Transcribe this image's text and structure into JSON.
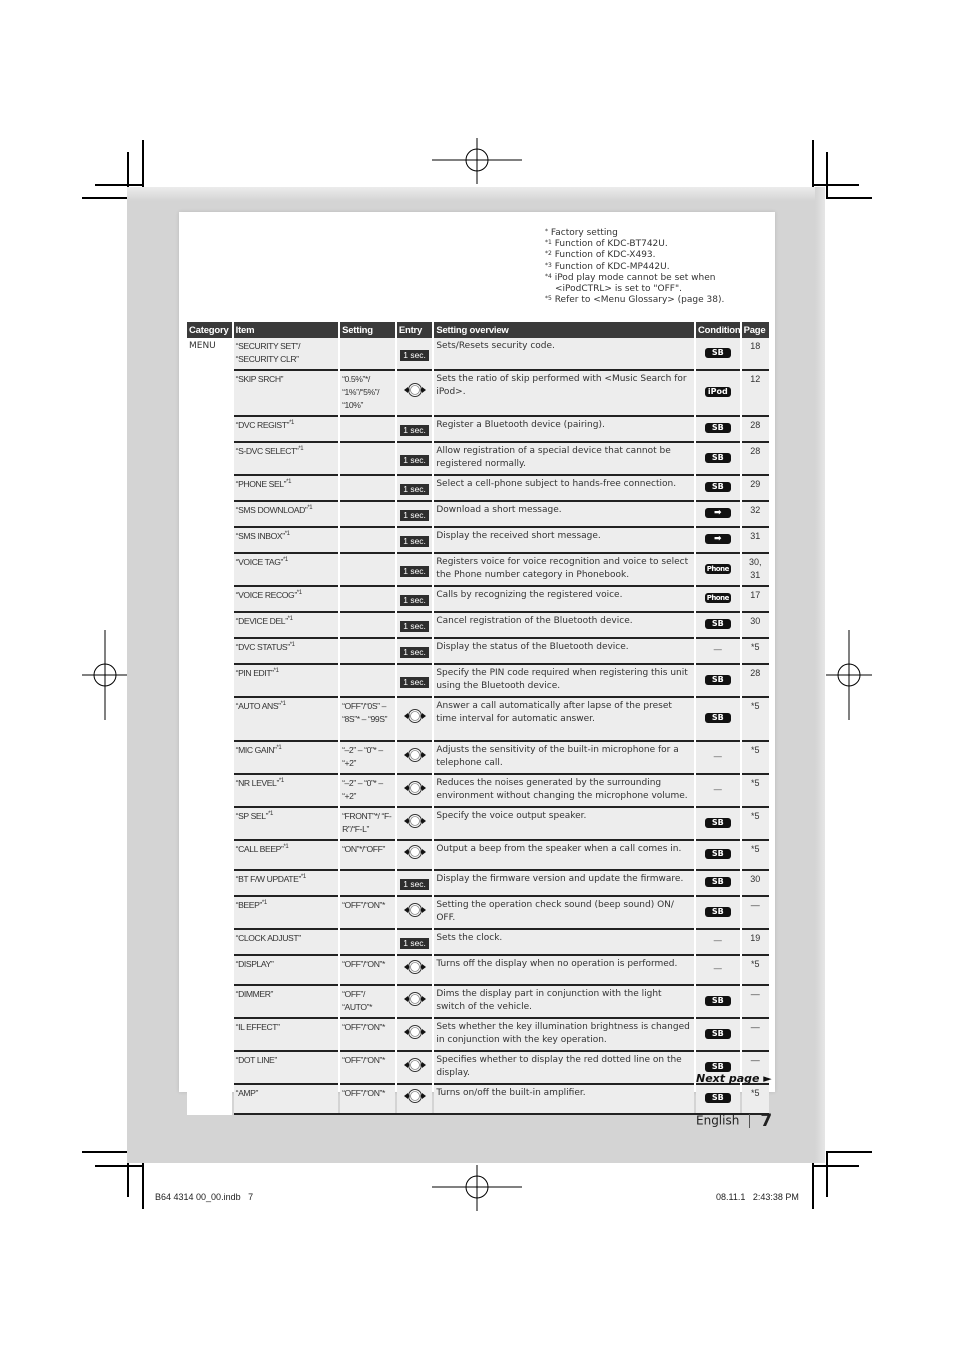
{
  "footnotes": [
    {
      "mark": "*",
      "text": "Factory setting"
    },
    {
      "mark": "*1",
      "text": "Function of KDC-BT742U."
    },
    {
      "mark": "*2",
      "text": "Function of KDC-X493."
    },
    {
      "mark": "*3",
      "text": "Function of KDC-MP442U."
    },
    {
      "mark": "*4",
      "text": "iPod play mode cannot be set when",
      "cont": "<iPodCTRL> is set to \"OFF\"."
    },
    {
      "mark": "*5",
      "text": "Refer to <Menu Glossary> (page 38)."
    }
  ],
  "table": {
    "headers": [
      "Category",
      "Item",
      "Setting",
      "Entry",
      "Setting overview",
      "Condition",
      "Page"
    ],
    "category": "MENU",
    "rows": [
      {
        "item": "“SECURITY SET”/ “SECURITY CLR”",
        "sup": "",
        "setting": "",
        "entry": "1 sec.",
        "overview": "Sets/Resets security code.",
        "condition": "SB",
        "page": "18"
      },
      {
        "item": "“SKIP SRCH”",
        "sup": "",
        "setting": "“0.5%”*/ “1%”/“5%”/ “10%”",
        "entry": "knob",
        "overview": "Sets the ratio of skip performed with <Music Search for iPod>.",
        "condition": "iPod",
        "page": "12"
      },
      {
        "item": "“DVC REGIST”",
        "sup": "*1",
        "setting": "",
        "entry": "1 sec.",
        "overview": "Register a Bluetooth device (pairing).",
        "condition": "SB",
        "page": "28"
      },
      {
        "item": "“S-DVC SELECT”",
        "sup": "*1",
        "setting": "",
        "entry": "1 sec.",
        "overview": "Allow registration of a special device that cannot be registered normally.",
        "condition": "SB",
        "page": "28"
      },
      {
        "item": "“PHONE SEL”",
        "sup": "*1",
        "setting": "",
        "entry": "1 sec.",
        "overview": "Select a cell-phone subject to hands-free connection.",
        "condition": "SB",
        "page": "29"
      },
      {
        "item": "“SMS DOWNLOAD”",
        "sup": "*1",
        "setting": "",
        "entry": "1 sec.",
        "overview": "Download a short message.",
        "condition": "arrow",
        "page": "32"
      },
      {
        "item": "“SMS INBOX”",
        "sup": "*1",
        "setting": "",
        "entry": "1 sec.",
        "overview": "Display the received short message.",
        "condition": "arrow",
        "page": "31"
      },
      {
        "item": "“VOICE TAG”",
        "sup": "*1",
        "setting": "",
        "entry": "1 sec.",
        "overview": "Registers voice for voice recognition and voice to select the Phone number category in Phonebook.",
        "condition": "Phone",
        "page": "30, 31"
      },
      {
        "item": "“VOICE RECOG”",
        "sup": "*1",
        "setting": "",
        "entry": "1 sec.",
        "overview": "Calls by recognizing the registered voice.",
        "condition": "Phone",
        "page": "17"
      },
      {
        "item": "“DEVICE DEL”",
        "sup": "*1",
        "setting": "",
        "entry": "1 sec.",
        "overview": "Cancel registration of the Bluetooth device.",
        "condition": "SB",
        "page": "30"
      },
      {
        "item": "“DVC STATUS”",
        "sup": "*1",
        "setting": "",
        "entry": "1 sec.",
        "overview": "Display the status of the Bluetooth device.",
        "condition": "—",
        "page": "*5"
      },
      {
        "item": "“PIN EDIT”",
        "sup": "*1",
        "setting": "",
        "entry": "1 sec.",
        "overview": "Specify the PIN code required when registering this unit using the Bluetooth device.",
        "condition": "SB",
        "page": "28"
      },
      {
        "item": "“AUTO ANS”",
        "sup": "*1",
        "setting": "“OFF”/“0S” – “8S”* – “99S”",
        "entry": "knob",
        "overview": "Answer a call automatically after lapse of the preset time interval for automatic answer.",
        "condition": "SB",
        "page": "*5"
      },
      {
        "item": "“MIC GAIN”",
        "sup": "*1",
        "setting": "“–2” – “0”* – “+2”",
        "entry": "knob",
        "overview": "Adjusts the sensitivity of the built-in microphone for a telephone call.",
        "condition": "—",
        "page": "*5"
      },
      {
        "item": "“NR LEVEL”",
        "sup": "*1",
        "setting": "“–2” – “0”* – “+2”",
        "entry": "knob",
        "overview": "Reduces the noises generated by the surrounding environment without changing the microphone volume.",
        "condition": "—",
        "page": "*5"
      },
      {
        "item": "“SP SEL”",
        "sup": "*1",
        "setting": "“FRONT”*/ “F-R”/“F-L”",
        "entry": "knob",
        "overview": "Specify the voice output speaker.",
        "condition": "SB",
        "page": "*5"
      },
      {
        "item": "“CALL BEEP”",
        "sup": "*1",
        "setting": "“ON”*/“OFF”",
        "entry": "knob",
        "overview": "Output a beep from the speaker when a call comes in.",
        "condition": "SB",
        "page": "*5"
      },
      {
        "item": "“BT F/W UPDATE”",
        "sup": "*1",
        "setting": "",
        "entry": "1 sec.",
        "overview": "Display the firmware version and update the firmware.",
        "condition": "SB",
        "page": "30"
      },
      {
        "item": "“BEEP”",
        "sup": "*1",
        "setting": "“OFF”/“ON”*",
        "entry": "knob",
        "overview": "Setting the operation check sound (beep sound) ON/ OFF.",
        "condition": "SB",
        "page": "—"
      },
      {
        "item": "“CLOCK ADJUST”",
        "sup": "",
        "setting": "",
        "entry": "1 sec.",
        "overview": "Sets the clock.",
        "condition": "—",
        "page": "19"
      },
      {
        "item": "“DISPLAY”",
        "sup": "",
        "setting": "“OFF”/“ON”*",
        "entry": "knob",
        "overview": "Turns off the display when no operation is performed.",
        "condition": "—",
        "page": "*5"
      },
      {
        "item": "“DIMMER”",
        "sup": "",
        "setting": "“OFF”/ “AUTO”*",
        "entry": "knob",
        "overview": "Dims the display part in conjunction with the light switch of the vehicle.",
        "condition": "SB",
        "page": "—"
      },
      {
        "item": "“IL EFFECT”",
        "sup": "",
        "setting": "“OFF”/“ON”*",
        "entry": "knob",
        "overview": "Sets whether the key illumination brightness is changed in conjunction with the key operation.",
        "condition": "SB",
        "page": "—"
      },
      {
        "item": "“DOT LINE”",
        "sup": "",
        "setting": "“OFF”/“ON”*",
        "entry": "knob",
        "overview": "Specifies whether to display the red dotted line on the display.",
        "condition": "SB",
        "page": "—"
      },
      {
        "item": "“AMP”",
        "sup": "",
        "setting": "“OFF”/“ON”*",
        "entry": "knob",
        "overview": "Turns on/off the built-in amplifier.",
        "condition": "SB",
        "page": "*5"
      }
    ]
  },
  "next_page": "Next page ►",
  "footer": {
    "language": "English",
    "page_number": "7"
  },
  "print_info": {
    "file": "B64 4314 00_00.indb   7",
    "timestamp": "08.11.1   2:43:38 PM"
  }
}
